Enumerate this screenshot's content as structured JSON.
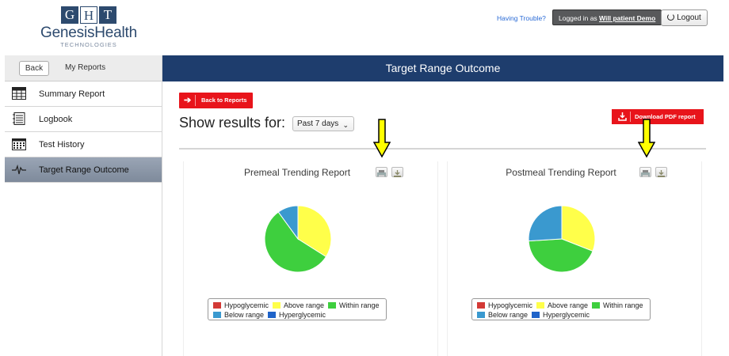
{
  "logo": {
    "letters": [
      "G",
      "H",
      "T"
    ],
    "name": "GenesisHealth",
    "sub": "TECHNOLOGIES"
  },
  "header": {
    "trouble_link": "Having Trouble?",
    "logged_prefix": "Logged in as ",
    "user_name": "Will patient Demo",
    "logout_label": "Logout"
  },
  "sidebar": {
    "back_label": "Back",
    "section_label": "My Reports",
    "items": [
      {
        "label": "Summary Report",
        "icon": "table-icon"
      },
      {
        "label": "Logbook",
        "icon": "notebook-icon"
      },
      {
        "label": "Test History",
        "icon": "calendar-icon"
      },
      {
        "label": "Target Range Outcome",
        "icon": "pulse-icon",
        "active": true
      }
    ]
  },
  "page_title": "Target Range Outcome",
  "content": {
    "back_to_reports": "Back to Reports",
    "show_results_label": "Show results for:",
    "period_value": "Past 7 days",
    "download_label": "Download PDF report"
  },
  "colors": {
    "navy": "#1e3d6d",
    "red": "#e8141b",
    "hypoglycemic": "#d33a36",
    "above": "#ffff4a",
    "within": "#3ecf3e",
    "below": "#3a99cf",
    "hyperglycemic": "#1f63c9"
  },
  "legend": [
    "Hypoglycemic",
    "Above range",
    "Within range",
    "Below range",
    "Hyperglycemic"
  ],
  "chart_data": [
    {
      "type": "pie",
      "title": "Premeal Trending Report",
      "categories": [
        "Hypoglycemic",
        "Above range",
        "Within range",
        "Below range",
        "Hyperglycemic"
      ],
      "values": [
        0,
        34,
        56,
        10,
        0
      ]
    },
    {
      "type": "pie",
      "title": "Postmeal Trending Report",
      "categories": [
        "Hypoglycemic",
        "Above range",
        "Within range",
        "Below range",
        "Hyperglycemic"
      ],
      "values": [
        0,
        31,
        43,
        26,
        0
      ]
    }
  ]
}
